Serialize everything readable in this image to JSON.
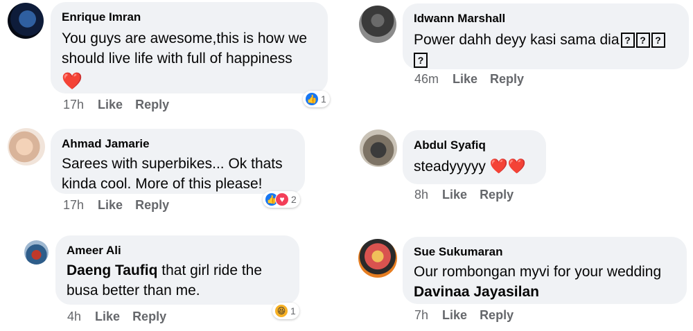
{
  "comments": [
    {
      "author": "Enrique Imran",
      "lines": [
        "You guys are awesome,this is how we",
        "should live life with full of happiness"
      ],
      "emoji": "❤️",
      "time": "17h",
      "like": "Like",
      "reply": "Reply",
      "reaction_count": "1"
    },
    {
      "author": "Idwann Marshall",
      "line1": "Power dahh deyy kasi sama dia",
      "q": "?",
      "time": "46m",
      "like": "Like",
      "reply": "Reply"
    },
    {
      "author": "Ahmad Jamarie",
      "lines": [
        "Sarees with superbikes... Ok thats",
        "kinda cool. More of this please!"
      ],
      "time": "17h",
      "like": "Like",
      "reply": "Reply",
      "reaction_count": "2"
    },
    {
      "author": "Abdul Syafiq",
      "text": "steadyyyyy ❤️❤️",
      "time": "8h",
      "like": "Like",
      "reply": "Reply"
    },
    {
      "author": "Ameer Ali",
      "mention": "Daeng Taufiq",
      "line1_rest": " that girl ride the",
      "line2": "busa better than me.",
      "time": "4h",
      "like": "Like",
      "reply": "Reply",
      "reaction_count": "1"
    },
    {
      "author": "Sue Sukumaran",
      "line1": "Our rombongan myvi for your wedding",
      "mention": "Davinaa Jayasilan",
      "time": "7h",
      "like": "Like",
      "reply": "Reply"
    }
  ],
  "colors": {
    "bubble": "#f0f2f5",
    "meta": "#65676b",
    "like_blue": "#1877f2",
    "love_red": "#f33e58",
    "haha_yellow": "#f7b125"
  },
  "icons": [
    "like-reaction-icon",
    "love-reaction-icon",
    "haha-reaction-icon",
    "heart-emoji",
    "unknown-glyph-box"
  ]
}
